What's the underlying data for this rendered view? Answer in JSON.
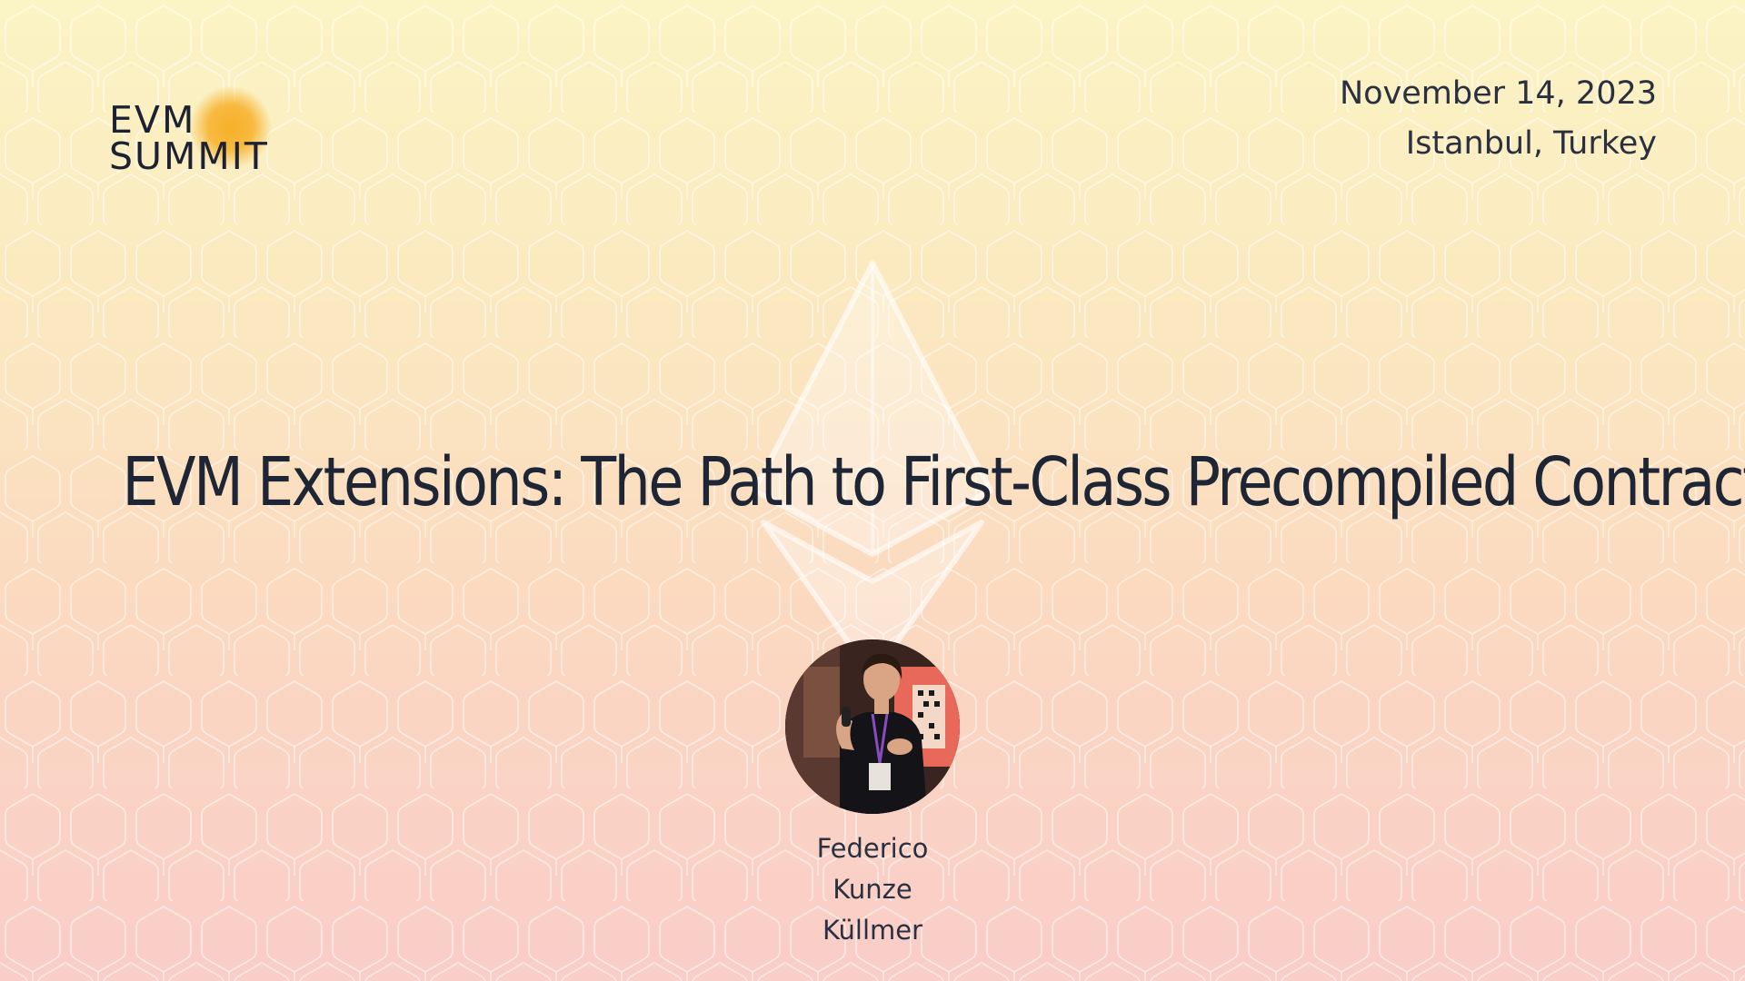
{
  "logo": {
    "line1": "EVM",
    "line2": "SUMMIT",
    "glow_color": "#f7b028"
  },
  "event": {
    "date": "November 14, 2023",
    "location": "Istanbul, Turkey"
  },
  "talk": {
    "title": "EVM Extensions: The Path to First-Class Precompiled Contracts"
  },
  "speaker": {
    "first_name": "Federico",
    "middle_name": "Kunze",
    "last_name": "Küllmer",
    "photo_icon": "speaker-photo"
  },
  "colors": {
    "background_top": "#fbf4c4",
    "background_bottom": "#f9cdc8",
    "text": "#1e2636"
  }
}
